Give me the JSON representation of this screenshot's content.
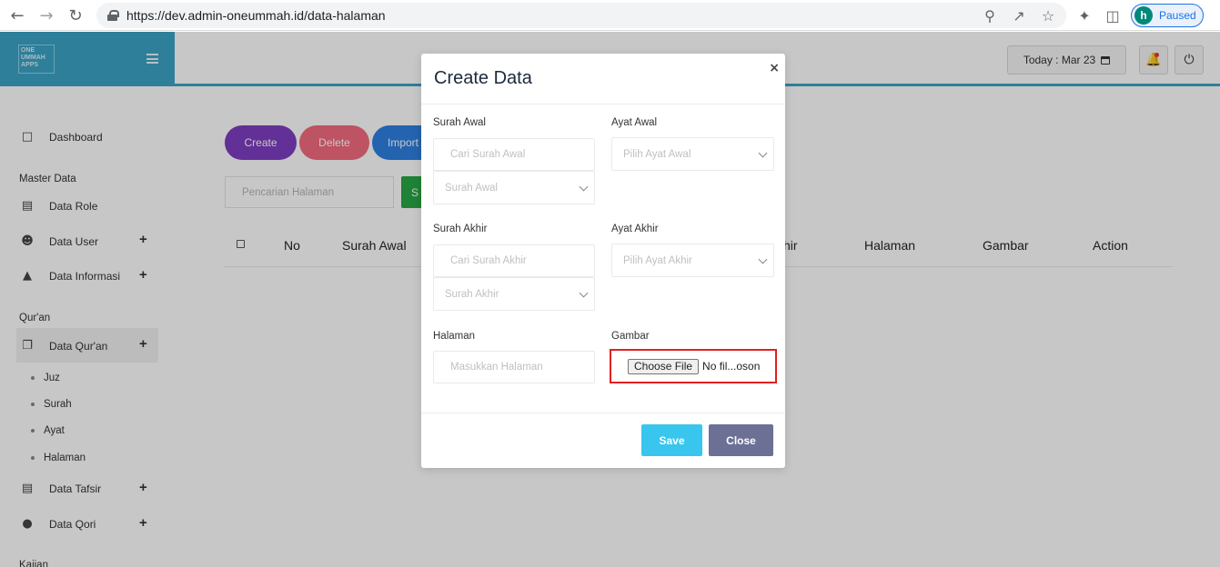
{
  "browser": {
    "url": "https://dev.admin-oneummah.id/data-halaman",
    "profile_initial": "h",
    "profile_status": "Paused",
    "icons": [
      "back-arrow-icon",
      "forward-arrow-icon",
      "reload-icon",
      "lock-icon",
      "zoom-icon",
      "share-icon",
      "star-icon",
      "extensions-icon",
      "side-panel-icon"
    ]
  },
  "app": {
    "logo_text": "ONE UMMAH APPS",
    "today_label": "Today : Mar 23",
    "accent_color": "#3ba3c6"
  },
  "sidebar": {
    "dashboard": "Dashboard",
    "master_data": "Master Data",
    "data_role": "Data Role",
    "data_user": "Data User",
    "data_informasi": "Data Informasi",
    "quran_section": "Qur'an",
    "data_quran": "Data Qur'an",
    "sub_items": [
      "Juz",
      "Surah",
      "Ayat",
      "Halaman"
    ],
    "data_tafsir": "Data Tafsir",
    "data_qori": "Data Qori",
    "kajian_section": "Kajian",
    "plus": "+"
  },
  "toolbar": {
    "create": "Create",
    "delete": "Delete",
    "import": "Import",
    "search_placeholder": "Pencarian Halaman",
    "search_btn": "S"
  },
  "table": {
    "headers": [
      "No",
      "Surah Awal",
      "hir",
      "Halaman",
      "Gambar",
      "Action"
    ]
  },
  "modal": {
    "title": "Create Data",
    "close_x": "×",
    "surah_awal_label": "Surah Awal",
    "surah_awal_search": "Cari Surah Awal",
    "surah_awal_select": "Surah Awal",
    "ayat_awal_label": "Ayat Awal",
    "ayat_awal_select": "Pilih Ayat Awal",
    "surah_akhir_label": "Surah Akhir",
    "surah_akhir_search": "Cari Surah Akhir",
    "surah_akhir_select": "Surah Akhir",
    "ayat_akhir_label": "Ayat Akhir",
    "ayat_akhir_select": "Pilih Ayat Akhir",
    "halaman_label": "Halaman",
    "halaman_placeholder": "Masukkan Halaman",
    "gambar_label": "Gambar",
    "choose_file": "Choose File",
    "no_file": "No fil...oson",
    "save": "Save",
    "close": "Close",
    "highlight_color": "#e02020"
  }
}
